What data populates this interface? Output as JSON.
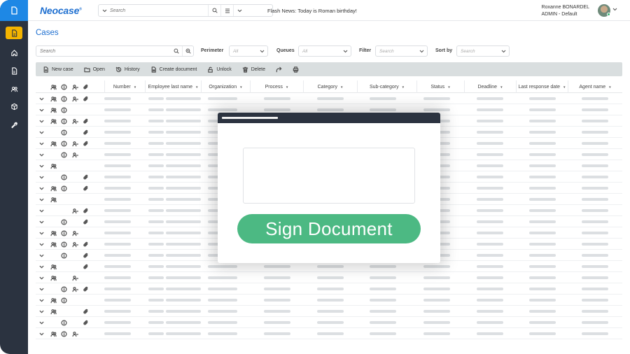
{
  "app": {
    "brand": "Neocase",
    "brand_mark": "®"
  },
  "header": {
    "search_placeholder": "Search",
    "flash_news": "Flash News: Today is Roman birthday!",
    "user_name": "Roxanne  BONARDEL",
    "user_role": "ADMIN - Default"
  },
  "sidebar": {
    "items": [
      {
        "name": "cases",
        "icon": "document-icon",
        "active": true
      },
      {
        "name": "home",
        "icon": "home-icon"
      },
      {
        "name": "documents",
        "icon": "file-icon"
      },
      {
        "name": "users",
        "icon": "users-icon"
      },
      {
        "name": "packages",
        "icon": "box-icon"
      },
      {
        "name": "tools",
        "icon": "wrench-icon"
      }
    ]
  },
  "page": {
    "title": "Cases"
  },
  "filters": {
    "search_placeholder": "Search",
    "perimeter_label": "Perimeter",
    "perimeter_value": "All",
    "queues_label": "Queues",
    "queues_value": "All",
    "filter_label": "Filter",
    "filter_placeholder": "Search",
    "sortby_label": "Sort by",
    "sortby_placeholder": "Search"
  },
  "toolbar": {
    "new_case": "New case",
    "open": "Open",
    "history": "History",
    "create_document": "Create document",
    "unlock": "Unlock",
    "delete": "Delete"
  },
  "table": {
    "columns": [
      "Number",
      "Employee last name",
      "Organization",
      "Process",
      "Category",
      "Sub-category",
      "Status",
      "Deadline",
      "Last response date",
      "Agent name"
    ],
    "rows": [
      {
        "u": 1,
        "i": 1,
        "a": 1,
        "c": 1
      },
      {
        "u": 1,
        "i": 1,
        "a": 0,
        "c": 0
      },
      {
        "u": 1,
        "i": 1,
        "a": 1,
        "c": 1
      },
      {
        "u": 0,
        "i": 1,
        "a": 0,
        "c": 1
      },
      {
        "u": 1,
        "i": 1,
        "a": 1,
        "c": 1
      },
      {
        "u": 0,
        "i": 1,
        "a": 1,
        "c": 0
      },
      {
        "u": 1,
        "i": 0,
        "a": 0,
        "c": 0
      },
      {
        "u": 0,
        "i": 1,
        "a": 0,
        "c": 1
      },
      {
        "u": 1,
        "i": 1,
        "a": 0,
        "c": 1
      },
      {
        "u": 1,
        "i": 0,
        "a": 0,
        "c": 0
      },
      {
        "u": 0,
        "i": 0,
        "a": 1,
        "c": 1
      },
      {
        "u": 0,
        "i": 1,
        "a": 0,
        "c": 1
      },
      {
        "u": 1,
        "i": 1,
        "a": 1,
        "c": 0
      },
      {
        "u": 1,
        "i": 1,
        "a": 1,
        "c": 1
      },
      {
        "u": 0,
        "i": 1,
        "a": 0,
        "c": 1
      },
      {
        "u": 1,
        "i": 0,
        "a": 0,
        "c": 1
      },
      {
        "u": 1,
        "i": 0,
        "a": 1,
        "c": 0
      },
      {
        "u": 0,
        "i": 1,
        "a": 1,
        "c": 1
      },
      {
        "u": 1,
        "i": 1,
        "a": 0,
        "c": 0
      },
      {
        "u": 1,
        "i": 0,
        "a": 0,
        "c": 1
      },
      {
        "u": 0,
        "i": 1,
        "a": 0,
        "c": 1
      },
      {
        "u": 1,
        "i": 1,
        "a": 1,
        "c": 0
      }
    ]
  },
  "modal": {
    "sign_label": "Sign Document"
  },
  "colors": {
    "sidebar": "#2b3340",
    "brand": "#1e6fd0",
    "accent": "#f4b400",
    "sign_button": "#4cb983"
  }
}
